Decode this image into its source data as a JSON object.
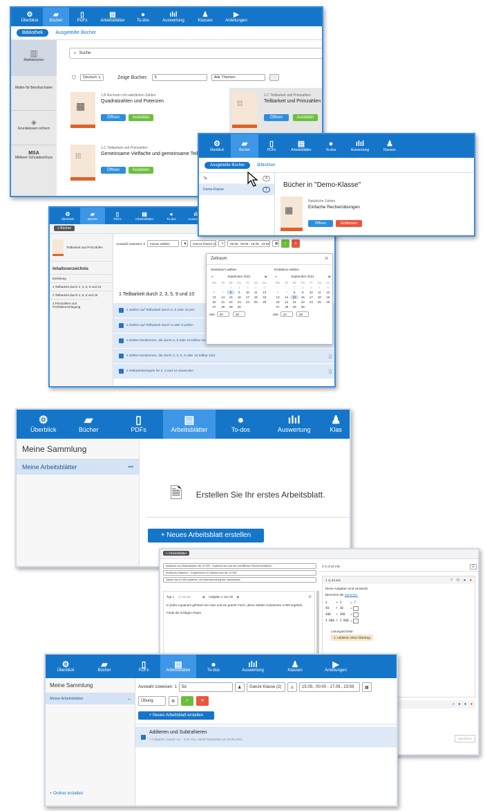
{
  "nav": {
    "overview": "Überblick",
    "books": "Bücher",
    "pdfs": "PDFs",
    "worksheets": "Arbeitsblätter",
    "todos": "To-dos",
    "evaluation": "Auswertung",
    "classes": "Klassen",
    "guides": "Anleitungen",
    "classes_cut": "Klas"
  },
  "s1": {
    "tab_library": "Bibliothek",
    "tab_lent": "Ausgeteilte Bücher",
    "search": "Suche",
    "lang": "Deutsch ∨",
    "show_label": "Zeige Bücher:",
    "show_val": "6",
    "topics": "Alle Themen",
    "side": [
      "Mathebücher",
      "Mathe für Berufsschulen",
      "Grundwissen sichern",
      "MSA",
      "Mittlerer Schulabschluss"
    ],
    "books": [
      {
        "sub": "1.B Rechnen mit natürlichen Zahlen",
        "title": "Quadratzahlen und Potenzen"
      },
      {
        "sub": "1.C Teilbarkeit und Primzahlen",
        "title": "Teilbarkeit und Primzahlen"
      },
      {
        "sub": "1.C Teilbarkeit und Primzahlen",
        "title": "Gemeinsame Vielfache und gemeinsame Teiler"
      }
    ],
    "open": "Öffnen",
    "lend": "Austeilen"
  },
  "s2": {
    "tab_lent": "Ausgeteilte Bücher",
    "tab_library": "Bibliothek",
    "classes": [
      {
        "name": "7a",
        "count": "0"
      },
      {
        "name": "Demo-Klasse",
        "count": "1"
      }
    ],
    "heading": "Bücher in \"Demo-Klasse\"",
    "book_sub": "Natürliche Zahlen",
    "book_title": "Einfache Rechenübungen",
    "open": "Öffnen",
    "remove": "Entfernen"
  },
  "s3": {
    "back": "< Bücher",
    "book": "Teilbarkeit und Primzahlen",
    "assign_label": "Auswahl zuweisen: 6",
    "class_sel": "Klasse wählen",
    "whole": "Ganze Klasse (2(",
    "range": "08.09., 00:00 - 15.09., 23:59",
    "toc": "Inhaltsverzeichnis",
    "toc_items": [
      "Einleitung",
      "1 Teilbarkeit durch 2, 3, 5, 9 und 10",
      "2 Teilbarkeit durch 4, 6, 8 und 25",
      "3 Primzahlen und Primfaktorzerlegung"
    ],
    "section": "1  Teilbarkeit durch 2, 3, 5, 9 und 10",
    "rows": [
      "1  Zahlen auf Teilbarkeit durch 2, 5 oder 10 prü",
      "2  Zahlen auf Teilbarkeit durch 3 oder 9 prüfen",
      "3  Zahlen bestimmen, die durch 2, 5 oder 10 teilbar sind",
      "4  Zahlen bestimmen, die durch 2, 3, 5, 9 oder 10 teilbar sind",
      "5  Teilbarkeitsregeln für 2, 3 und 10 anwenden"
    ],
    "cal": {
      "title": "Zeitraum",
      "start_label": "Startdatum wählen",
      "end_label": "Enddatum wählen",
      "month": "September 2021",
      "dow": [
        "Mo",
        "Di",
        "Mi",
        "Do",
        "Fr",
        "Sa",
        "So"
      ],
      "weeks": [
        [
          "",
          "",
          "1",
          "2",
          "3",
          "4",
          "5"
        ],
        [
          "6",
          "7",
          "8",
          "9",
          "10",
          "11",
          "12"
        ],
        [
          "13",
          "14",
          "15",
          "16",
          "17",
          "18",
          "19"
        ],
        [
          "20",
          "21",
          "22",
          "23",
          "24",
          "25",
          "26"
        ],
        [
          "27",
          "28",
          "29",
          "30",
          "",
          "",
          ""
        ]
      ],
      "time_label": "Zeit:",
      "start_time": [
        "00",
        "00"
      ],
      "end_time": [
        "23",
        "59"
      ]
    }
  },
  "s4": {
    "sidebar_title": "Meine Sammlung",
    "folder": "Meine Arbeitsblätter",
    "dots": "•••",
    "empty_text": "Erstellen Sie Ihr erstes Arbeitsblatt.",
    "new_button": "+ Neues Arbeitsblatt erstellen"
  },
  "s5": {
    "back": "< Arbeitsblätter",
    "selects": [
      "Addieren und Subtrahieren bis 10 000 - Kopfrechnen und die schriftlichen Rechenverfahren",
      "Einfaches Addieren - Kopfrechnen im Zahlenraum bis 10 000",
      "Zahlen bis 10 000 addieren, mit Überschreitung des Tausenders"
    ],
    "type": "Typ 1",
    "time": "◷ 44 sec",
    "task": "Aufgabe 1 von 20",
    "text": "In jedes Aquarium gehören ein roter und ein grüner Fisch, deren Zahlen zusammen 3 000 ergeben.",
    "text2": "Finde die richtigen Paare.",
    "right_head": "4  ◷ 3:10 min",
    "right_num": "1  ◷ 44 sec",
    "used": "Diese Aufgaben sind verwandt.",
    "calc": "Berechne die",
    "sums": "Summen.",
    "eqs": [
      "4     + 3     = 7",
      "40    + 30    =",
      "400   + 300   =",
      "4 000 + 3 000 ="
    ],
    "steps_label": "Lösungsschritte:",
    "step1": "1. Addieren ohne Übertrag",
    "save": "Speichern"
  },
  "s6": {
    "sidebar_title": "Meine Sammlung",
    "folder": "Meine Arbeitsblätter",
    "minus": "−",
    "assign_label": "Auswahl zuweisen: 1",
    "class_val": "5d",
    "whole": "Ganze Klasse (2(",
    "range": "15.09., 00:00 - 17.09., 23:59",
    "mode": "Übung",
    "new_button": "+ Neues Arbeitsblatt erstellen",
    "item_title": "Addieren und Subtrahieren",
    "item_meta": "7 Aufgaben, Dauer: ca. : 5:22 min, zuletzt bearbeitet am 15.09.2021",
    "new_folder": "+ Ordner erstellen"
  },
  "colors": {
    "nav": "#1576c9",
    "nav_active": "#3d97e6",
    "green": "#6cbf3c",
    "red": "#e8573e",
    "orange": "#e0622a"
  }
}
